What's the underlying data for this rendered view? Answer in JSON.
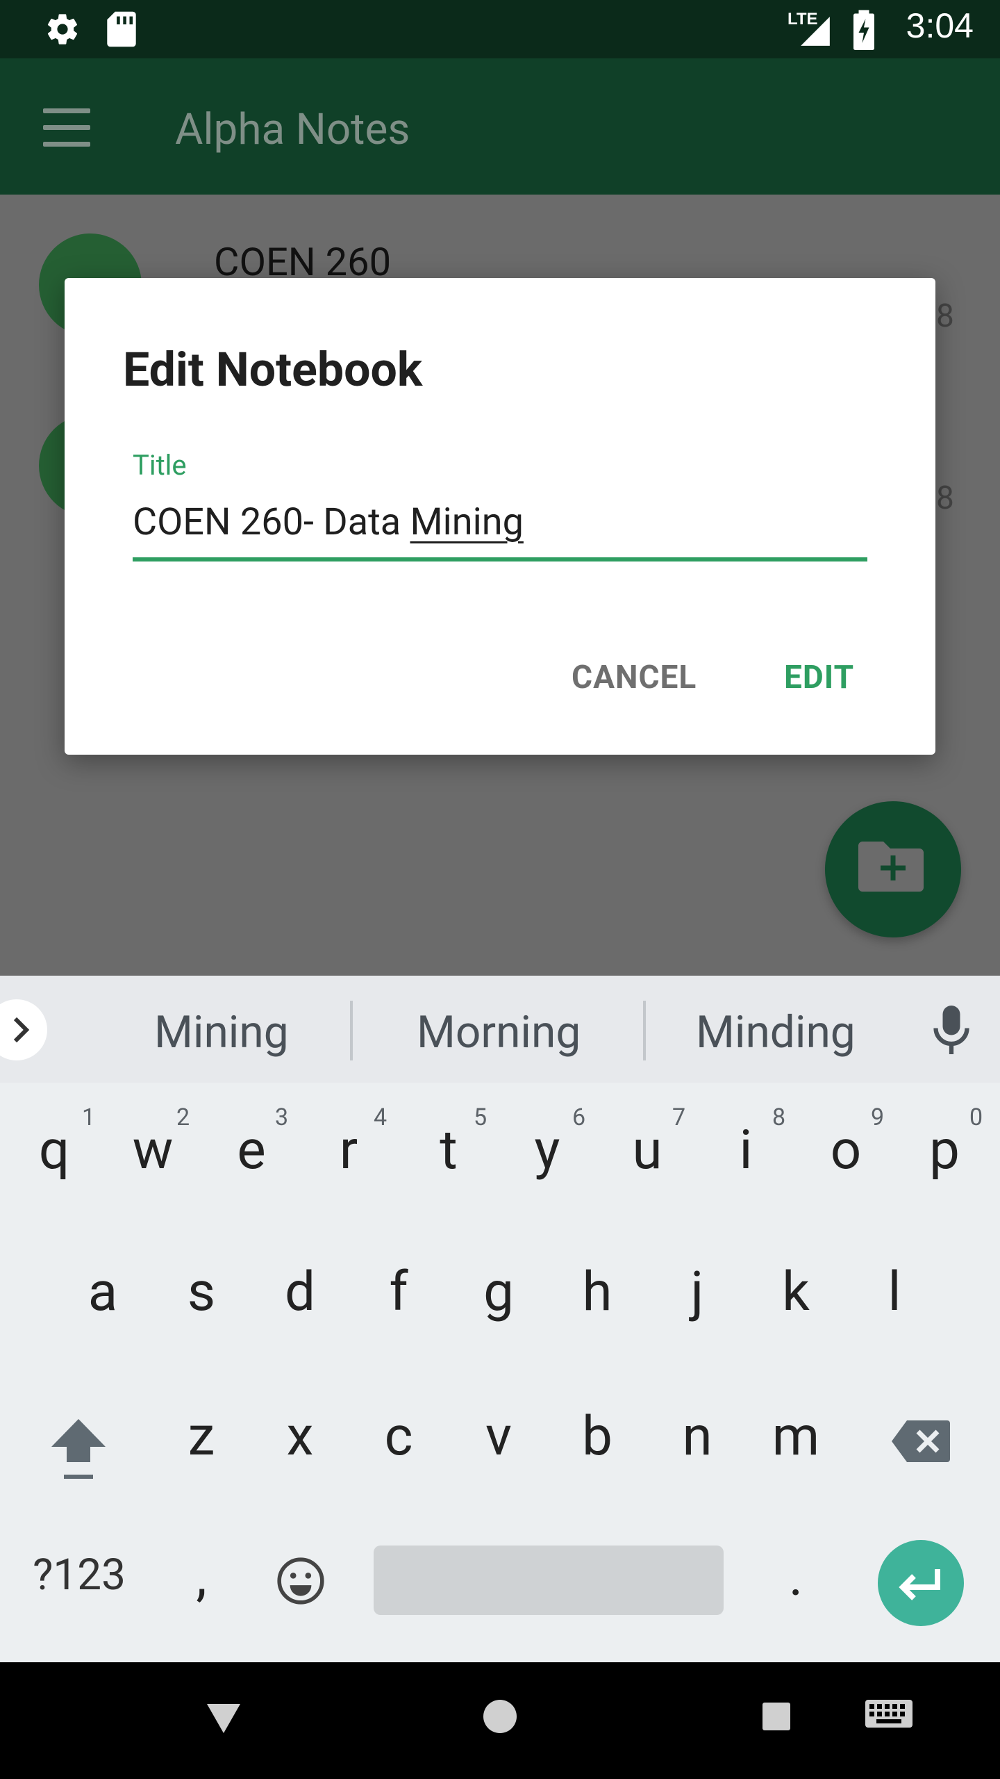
{
  "status_bar": {
    "time": "3:04",
    "network": "LTE",
    "icons": [
      "settings-icon",
      "sd-card-icon",
      "signal-icon",
      "battery-charging-icon"
    ]
  },
  "app_bar": {
    "title": "Alpha Notes",
    "menu_icon": "hamburger-menu-icon"
  },
  "background_list": {
    "items": [
      {
        "title": "COEN 260",
        "trailing": "8"
      },
      {
        "title": "",
        "trailing": "8"
      }
    ]
  },
  "fab": {
    "icon": "add-folder-icon"
  },
  "dialog": {
    "title": "Edit Notebook",
    "field_label": "Title",
    "field_value_prefix": "COEN 260- Data ",
    "field_value_composing": "Mining",
    "cancel_label": "CANCEL",
    "confirm_label": "EDIT",
    "accent_color": "#2e9e61"
  },
  "keyboard": {
    "suggestions": [
      "Mining",
      "Morning",
      "Minding"
    ],
    "row1": [
      "q",
      "w",
      "e",
      "r",
      "t",
      "y",
      "u",
      "i",
      "o",
      "p"
    ],
    "row1_numbers": [
      "1",
      "2",
      "3",
      "4",
      "5",
      "6",
      "7",
      "8",
      "9",
      "0"
    ],
    "row2": [
      "a",
      "s",
      "d",
      "f",
      "g",
      "h",
      "j",
      "k",
      "l"
    ],
    "row3": [
      "z",
      "x",
      "c",
      "v",
      "b",
      "n",
      "m"
    ],
    "symbols_label": "?123",
    "comma": ",",
    "period": ".",
    "enter_color": "#3fb39a"
  },
  "nav_bar": {
    "icons": [
      "back-icon",
      "home-icon",
      "recents-icon",
      "keyboard-switch-icon"
    ]
  }
}
